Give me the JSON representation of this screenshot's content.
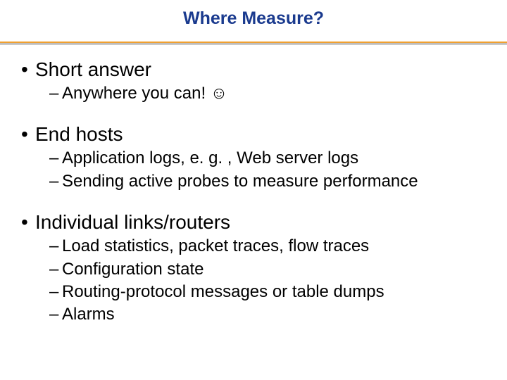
{
  "title": "Where Measure?",
  "bullets": [
    {
      "text": "Short answer",
      "subs": [
        "Anywhere you can! ☺"
      ]
    },
    {
      "text": "End hosts",
      "subs": [
        "Application logs, e. g. , Web server logs",
        "Sending active probes to measure performance"
      ]
    },
    {
      "text": "Individual links/routers",
      "subs": [
        "Load statistics, packet traces, flow traces",
        "Configuration state",
        "Routing-protocol messages or table dumps",
        "Alarms"
      ]
    }
  ]
}
